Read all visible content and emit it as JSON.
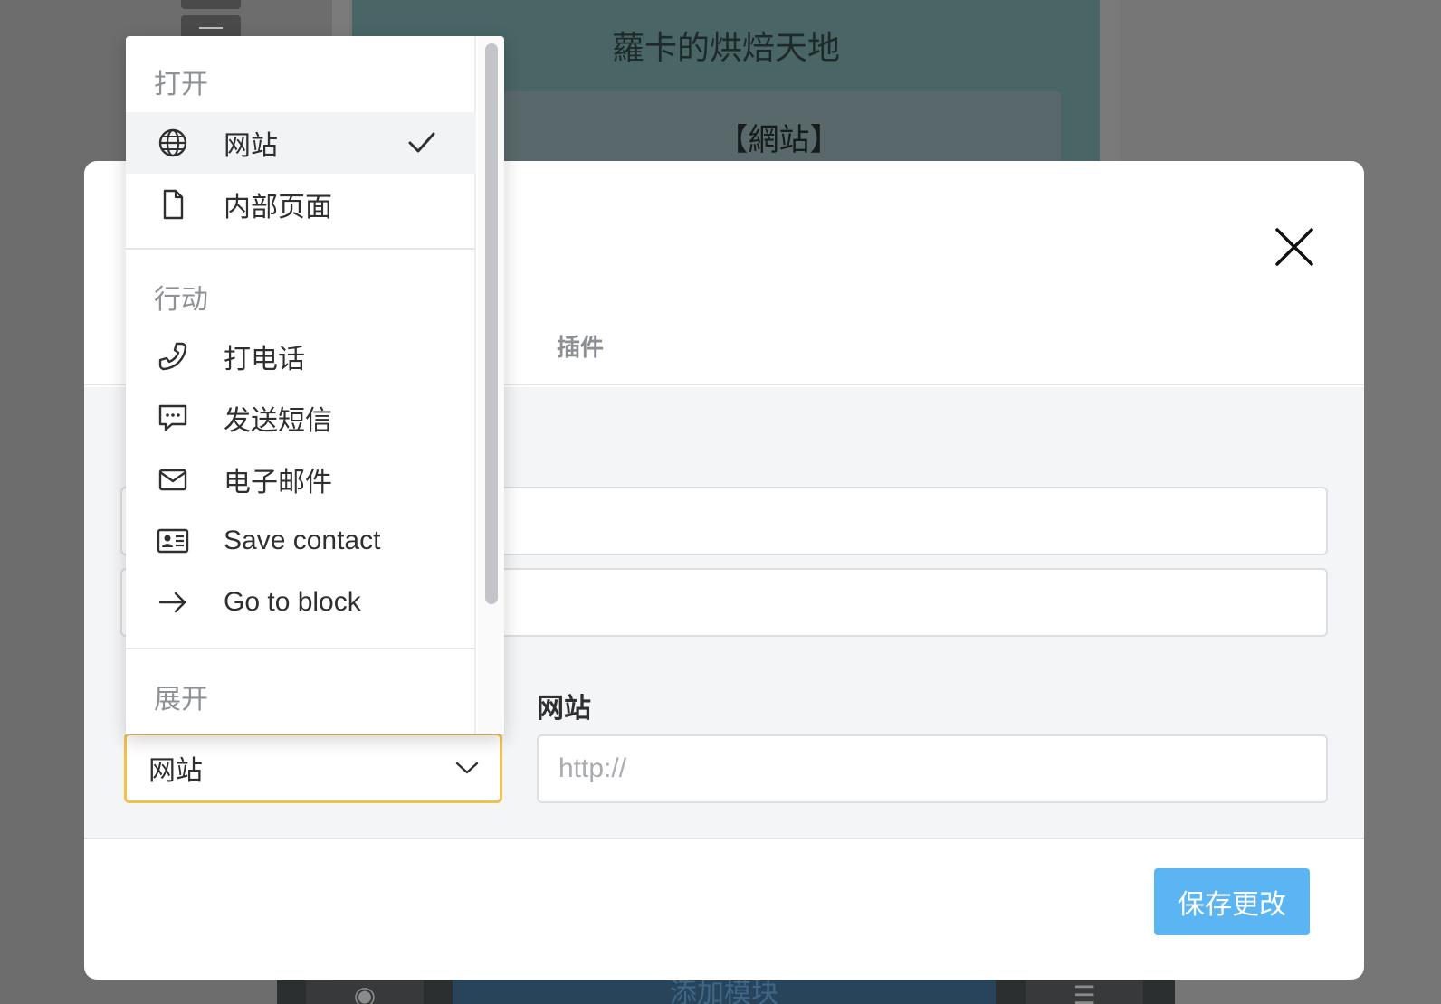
{
  "background": {
    "card_title": "蘿卡的烘焙天地",
    "link_button": "【網站】",
    "bottom_add_block": "添加模块",
    "eye_glyph": "◉",
    "sliders_glyph": "☰"
  },
  "modal": {
    "tabs": {
      "plugins": "插件"
    },
    "url_field": {
      "label": "网站",
      "placeholder": "http://",
      "value": ""
    },
    "link_type_select": {
      "value": "网站"
    },
    "save_button": "保存更改"
  },
  "menu": {
    "groups": [
      {
        "title": "打开",
        "items": [
          {
            "label": "网站",
            "icon": "globe-icon",
            "selected": true
          },
          {
            "label": "内部页面",
            "icon": "page-icon",
            "selected": false
          }
        ]
      },
      {
        "title": "行动",
        "items": [
          {
            "label": "打电话",
            "icon": "phone-icon"
          },
          {
            "label": "发送短信",
            "icon": "message-icon"
          },
          {
            "label": "电子邮件",
            "icon": "envelope-icon"
          },
          {
            "label": "Save contact",
            "icon": "contact-card-icon"
          },
          {
            "label": "Go to block",
            "icon": "arrow-right-icon"
          }
        ]
      },
      {
        "title": "展开",
        "items": []
      }
    ]
  },
  "colors": {
    "select_focus_border": "#f2c04d",
    "primary_button": "#5ab5f2",
    "overlay": "#767676"
  }
}
